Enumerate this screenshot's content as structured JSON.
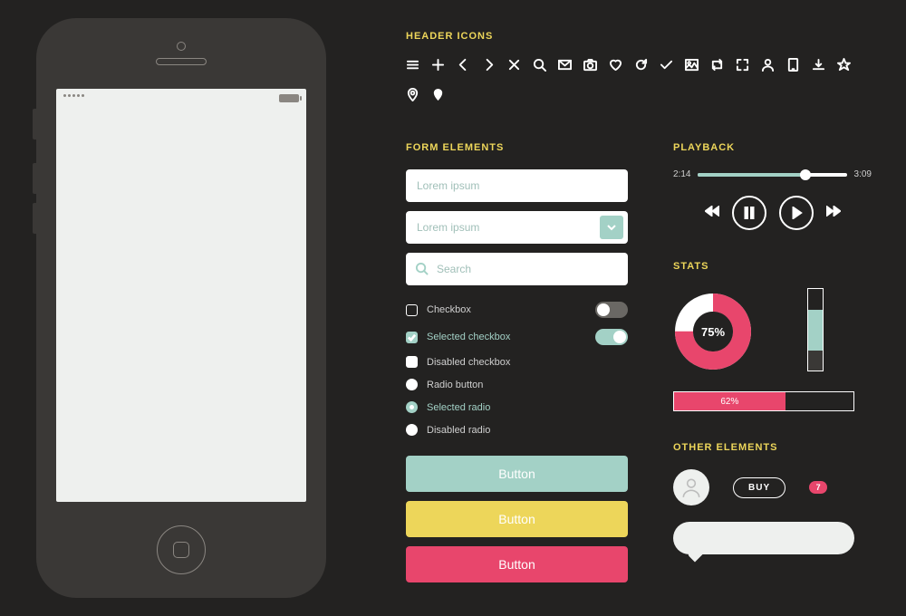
{
  "sections": {
    "header_icons": "HEADER ICONS",
    "form_elements": "FORM ELEMENTS",
    "playback": "PLAYBACK",
    "stats": "STATS",
    "other": "OTHER ELEMENTS"
  },
  "form": {
    "text_placeholder": "Lorem ipsum",
    "select_placeholder": "Lorem ipsum",
    "search_placeholder": "Search",
    "checkbox": "Checkbox",
    "checkbox_selected": "Selected checkbox",
    "checkbox_disabled": "Disabled checkbox",
    "radio": "Radio button",
    "radio_selected": "Selected radio",
    "radio_disabled": "Disabled radio",
    "button_label": "Button"
  },
  "playback": {
    "elapsed": "2:14",
    "total": "3:09",
    "progress_pct": 72
  },
  "stats": {
    "donut_pct": 75,
    "donut_label": "75%",
    "hbar_pct": 62,
    "hbar_label": "62%",
    "vbar_teal_pct": 50,
    "vbar_dark_pct": 25
  },
  "other": {
    "buy_label": "BUY",
    "badge_count": "7"
  },
  "chart_data": [
    {
      "type": "pie",
      "title": "",
      "series": [
        {
          "name": "filled",
          "value": 75,
          "color": "#e8466c"
        },
        {
          "name": "remaining",
          "value": 25,
          "color": "#ffffff"
        }
      ],
      "center_label": "75%"
    },
    {
      "type": "bar",
      "orientation": "vertical-stacked",
      "values": [
        {
          "segment": "dark",
          "value": 25
        },
        {
          "segment": "teal",
          "value": 50
        },
        {
          "segment": "empty",
          "value": 25
        }
      ],
      "ylim": [
        0,
        100
      ]
    },
    {
      "type": "bar",
      "orientation": "horizontal",
      "value": 62,
      "xlim": [
        0,
        100
      ],
      "label": "62%"
    }
  ]
}
